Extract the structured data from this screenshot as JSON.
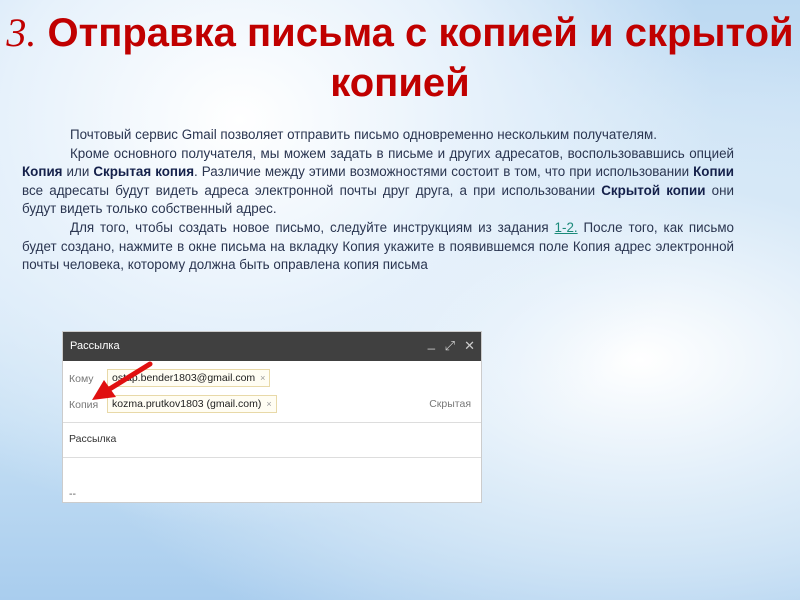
{
  "title": {
    "number": "3.",
    "text": "Отправка письма с копией и скрытой копией"
  },
  "paragraphs": {
    "p1": "Почтовый сервис Gmail позволяет отправить письмо одновременно нескольким получателям.",
    "p2a": "Кроме основного получателя, мы можем задать в письме и других адресатов, воспользовавшись опцией ",
    "p2b": "Копия",
    "p2c": " или ",
    "p2d": "Скрытая копия",
    "p2e": ". Различие между этими возможностями состоит в том, что при использовании ",
    "p2f": "Копии",
    "p2g": " все адресаты будут видеть адреса электронной почты друг друга, а при использовании ",
    "p2h": "Скрытой копии",
    "p2i": " они будут видеть только собственный адрес.",
    "p3a": "Для того, чтобы создать новое письмо, следуйте инструкциям из задания ",
    "p3link": "1-2.",
    "p3b": " После того, как письмо будет создано, нажмите в окне письма на вкладку Копия укажите в появившемся поле Копия адрес электронной почты человека, которому должна быть оправлена копия письма"
  },
  "compose": {
    "title": "Рассылка",
    "controls": {
      "minimize": "_",
      "expand": "⤢",
      "close": "✕"
    },
    "to_label": "Кому",
    "to_chip": "ostap.bender1803@gmail.com",
    "cc_label": "Копия",
    "cc_chip": "kozma.prutkov1803 (gmail.com)",
    "bcc_link": "Скрытая",
    "subject": "Рассылка",
    "signature": "--",
    "chip_remove": "×"
  },
  "colors": {
    "title": "#c00000",
    "arrow": "#e01010",
    "header": "#404040"
  }
}
